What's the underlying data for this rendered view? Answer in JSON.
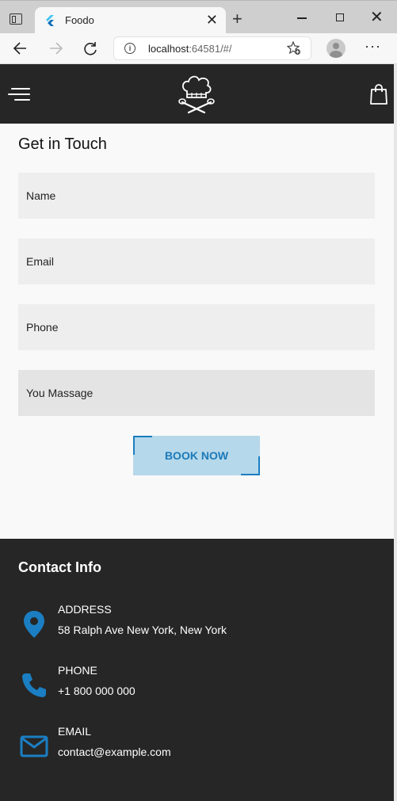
{
  "browser": {
    "tab_title": "Foodo",
    "url_host": "localhost",
    "url_rest": ":64581/#/",
    "new_tab_symbol": "+",
    "close_symbol": "✕",
    "more_symbol": "···"
  },
  "icons": {
    "tab_actions": "tab-actions-icon",
    "back": "arrow-left-icon",
    "forward": "arrow-right-icon",
    "reload": "reload-icon",
    "info": "info-icon",
    "favorites": "star-add-icon",
    "profile": "profile-icon",
    "menu": "hamburger-menu-icon",
    "logo": "chef-hat-logo-icon",
    "cart": "shopping-bag-icon",
    "location": "location-pin-icon",
    "phone": "phone-icon",
    "email": "mail-icon"
  },
  "colors": {
    "header_bg": "#262626",
    "accent": "#1b7ec2",
    "button_bg": "#b5d8ea",
    "field_bg": "#eeeeee"
  },
  "contact_form": {
    "title": "Get in Touch",
    "fields": [
      {
        "placeholder": "Name"
      },
      {
        "placeholder": "Email"
      },
      {
        "placeholder": "Phone"
      },
      {
        "placeholder": "You Massage"
      }
    ],
    "submit_label": "BOOK NOW"
  },
  "contact_info": {
    "title": "Contact Info",
    "items": [
      {
        "label": "ADDRESS",
        "value": "58 Ralph Ave New York, New York"
      },
      {
        "label": "PHONE",
        "value": "+1 800 000 000"
      },
      {
        "label": "EMAIL",
        "value": "contact@example.com"
      }
    ]
  }
}
